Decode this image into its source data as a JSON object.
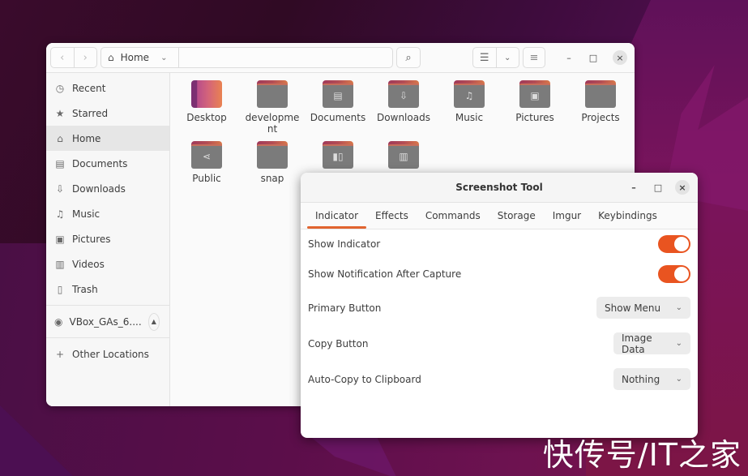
{
  "files_window": {
    "nav": {
      "back_icon": "chevron-left-icon",
      "forward_icon": "chevron-right-icon"
    },
    "path": {
      "icon": "home-icon",
      "label": "Home"
    },
    "toolbar": {
      "search_icon": "search-icon",
      "view_icon": "list-view-icon",
      "view_menu_icon": "chevron-down-icon",
      "menu_icon": "hamburger-menu-icon"
    },
    "window_controls": {
      "minimize": "–",
      "maximize": "□",
      "close": "×"
    },
    "sidebar": {
      "items": [
        {
          "label": "Recent",
          "icon": "clock-icon",
          "glyph": "◷"
        },
        {
          "label": "Starred",
          "icon": "star-icon",
          "glyph": "★"
        },
        {
          "label": "Home",
          "icon": "home-icon",
          "glyph": "⌂",
          "active": true
        },
        {
          "label": "Documents",
          "icon": "document-icon",
          "glyph": "▤"
        },
        {
          "label": "Downloads",
          "icon": "download-icon",
          "glyph": "⇩"
        },
        {
          "label": "Music",
          "icon": "music-icon",
          "glyph": "♫"
        },
        {
          "label": "Pictures",
          "icon": "picture-icon",
          "glyph": "▣"
        },
        {
          "label": "Videos",
          "icon": "video-icon",
          "glyph": "▥"
        },
        {
          "label": "Trash",
          "icon": "trash-icon",
          "glyph": "🗑"
        }
      ],
      "devices": [
        {
          "label": "VBox_GAs_6....",
          "icon": "disc-icon",
          "glyph": "◉",
          "eject": "▲"
        }
      ],
      "other": {
        "label": "Other Locations",
        "icon": "plus-icon",
        "glyph": "+"
      }
    },
    "files": [
      {
        "name": "Desktop",
        "type": "desktop",
        "emblem": ""
      },
      {
        "name": "developme\nnt",
        "type": "folder",
        "emblem": ""
      },
      {
        "name": "Documents",
        "type": "folder",
        "emblem": "▤"
      },
      {
        "name": "Downloads",
        "type": "folder",
        "emblem": "⇩"
      },
      {
        "name": "Music",
        "type": "folder",
        "emblem": "♫"
      },
      {
        "name": "Pictures",
        "type": "folder",
        "emblem": "▣"
      },
      {
        "name": "Projects",
        "type": "folder",
        "emblem": ""
      },
      {
        "name": "Public",
        "type": "folder",
        "emblem": "⋖"
      },
      {
        "name": "snap",
        "type": "folder",
        "emblem": ""
      },
      {
        "name": "",
        "type": "folder",
        "emblem": "▮▯"
      },
      {
        "name": "",
        "type": "folder",
        "emblem": "▥"
      }
    ]
  },
  "dialog": {
    "title": "Screenshot Tool",
    "window_controls": {
      "minimize": "–",
      "maximize": "□",
      "close": "×"
    },
    "tabs": [
      "Indicator",
      "Effects",
      "Commands",
      "Storage",
      "Imgur",
      "Keybindings"
    ],
    "active_tab": "Indicator",
    "settings": [
      {
        "label": "Show Indicator",
        "type": "toggle",
        "value": true
      },
      {
        "label": "Show Notification After Capture",
        "type": "toggle",
        "value": true
      },
      {
        "label": "Primary Button",
        "type": "combo",
        "value": "Show Menu"
      },
      {
        "label": "Copy Button",
        "type": "combo",
        "value": "Image Data"
      },
      {
        "label": "Auto-Copy to Clipboard",
        "type": "combo",
        "value": "Nothing"
      }
    ],
    "accent_color": "#e95420"
  },
  "watermark": "快传号/IT之家"
}
